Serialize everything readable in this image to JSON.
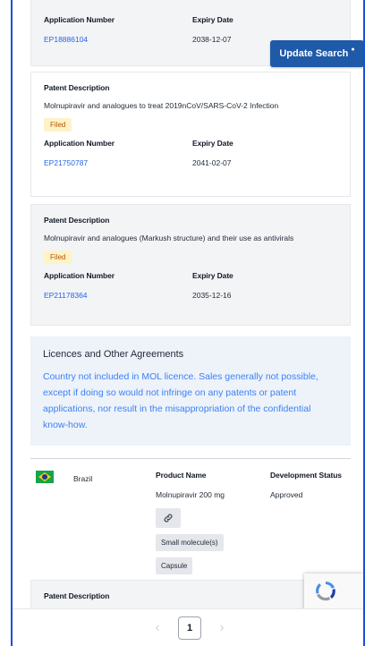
{
  "cards": [
    {
      "app_label": "Application Number",
      "expiry_label": "Expiry Date",
      "app_number": "EP18886104",
      "expiry": "2038-12-07"
    },
    {
      "desc_label": "Patent Description",
      "description": "Molnupiravir and analogues to treat 2019nCoV/SARS-CoV-2 Infection",
      "status": "Filed",
      "app_label": "Application Number",
      "expiry_label": "Expiry Date",
      "app_number": "EP21750787",
      "expiry": "2041-02-07"
    },
    {
      "desc_label": "Patent Description",
      "description": "Molnupiravir and analogues (Markush structure) and their use as antivirals",
      "status": "Filed",
      "app_label": "Application Number",
      "expiry_label": "Expiry Date",
      "app_number": "EP21178364",
      "expiry": "2035-12-16"
    }
  ],
  "update_search": {
    "label": "Update Search",
    "dot": "●"
  },
  "licence": {
    "title": "Licences and Other Agreements",
    "text": "Country not included in MOL licence. Sales generally not possible, except if doing so would not infringe on any patents or patent applications, nor result in the misappropriation of the confidential know-how."
  },
  "country": {
    "name": "Brazil",
    "product_label": "Product Name",
    "product": "Molnupiravir 200 mg",
    "dev_label": "Development Status",
    "dev_status": "Approved",
    "tags": [
      "Small molecule(s)",
      "Capsule"
    ],
    "link_icon": "link-icon",
    "desc_label": "Patent Description"
  },
  "pagination": {
    "prev": "‹",
    "current": "1",
    "next": "›"
  },
  "colors": {
    "accent": "#1e5aa8",
    "link": "#2563eb",
    "badge_bg": "#fef3c7",
    "badge_text": "#b45309"
  }
}
